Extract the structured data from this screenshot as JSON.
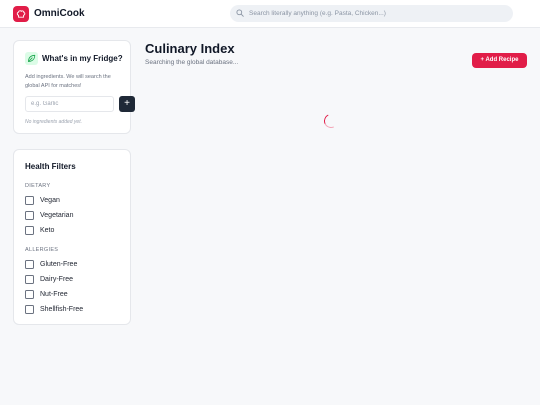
{
  "app": {
    "name": "OmniCook",
    "brand_color": "#e11d48"
  },
  "search": {
    "placeholder": "Search literally anything (e.g. Pasta, Chicken...)",
    "value": ""
  },
  "fridge": {
    "title": "What's in my Fridge?",
    "description": "Add ingredients. We will search the global API for matches!",
    "input_placeholder": "e.g. Garlic",
    "add_label": "+",
    "empty_text": "No ingredients added yet."
  },
  "health": {
    "title": "Health Filters",
    "dietary_label": "DIETARY",
    "dietary": [
      {
        "label": "Vegan",
        "checked": false
      },
      {
        "label": "Vegetarian",
        "checked": false
      },
      {
        "label": "Keto",
        "checked": false
      }
    ],
    "allergies_label": "ALLERGIES",
    "allergies": [
      {
        "label": "Gluten-Free",
        "checked": false
      },
      {
        "label": "Dairy-Free",
        "checked": false
      },
      {
        "label": "Nut-Free",
        "checked": false
      },
      {
        "label": "Shellfish-Free",
        "checked": false
      }
    ]
  },
  "main": {
    "title": "Culinary Index",
    "subtitle": "Searching the global database...",
    "add_recipe_label": "+ Add Recipe"
  },
  "icons": {
    "logo": "chef-hat-icon",
    "search": "search-icon",
    "fridge": "leaf-icon",
    "loading": "spinner-icon"
  }
}
